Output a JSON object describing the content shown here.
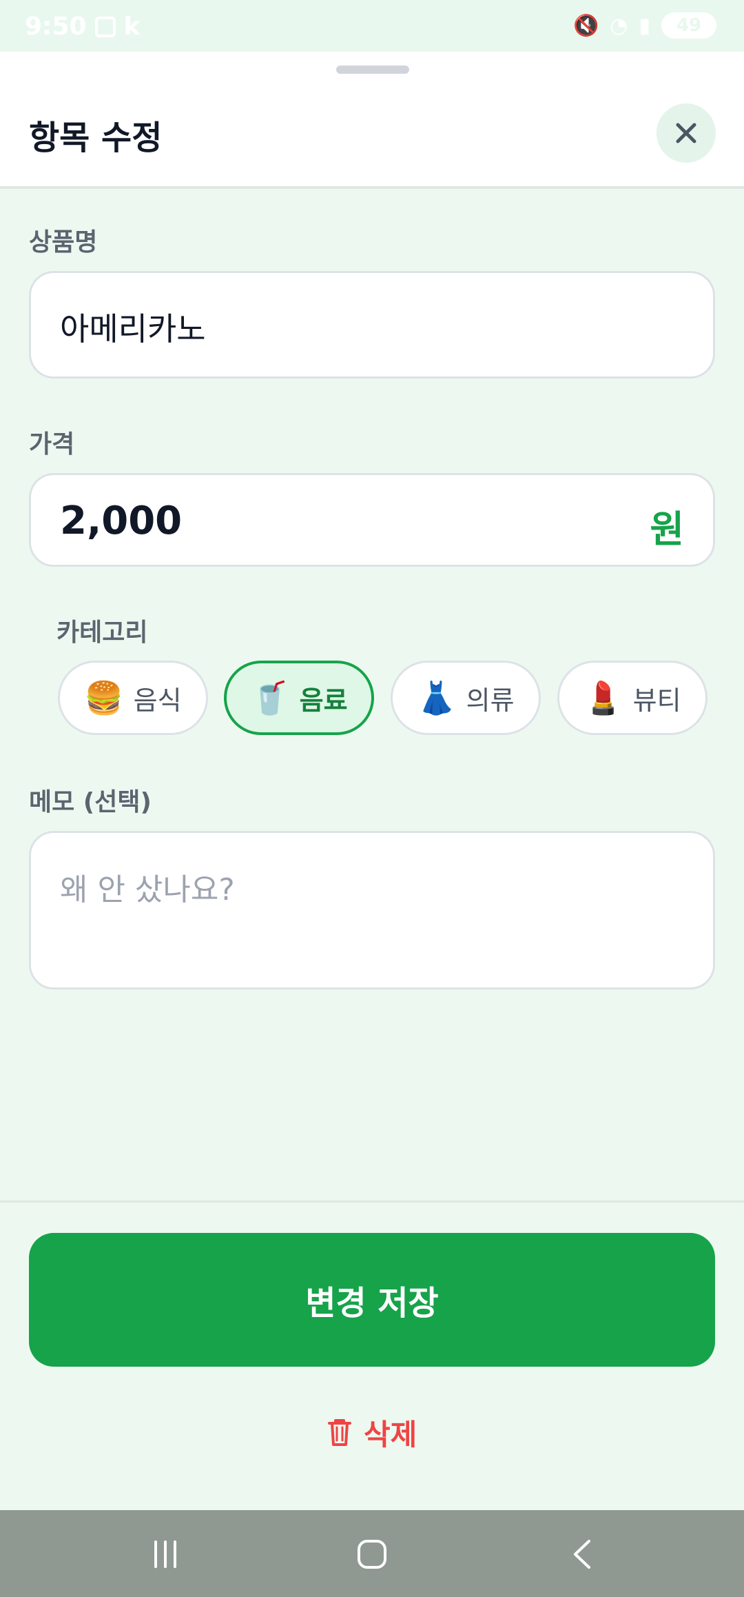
{
  "status_bar": {
    "time": "9:50",
    "carrier_indicator": "k",
    "battery": "49"
  },
  "sheet": {
    "title": "항목 수정"
  },
  "form": {
    "product_name": {
      "label": "상품명",
      "value": "아메리카노"
    },
    "price": {
      "label": "가격",
      "value": "2,000",
      "unit": "원"
    },
    "category": {
      "label": "카테고리",
      "options": [
        {
          "icon": "🍔",
          "icon_name": "burger-icon",
          "label": "음식",
          "selected": false
        },
        {
          "icon": "🥤",
          "icon_name": "drink-cup-icon",
          "label": "음료",
          "selected": true
        },
        {
          "icon": "👗",
          "icon_name": "dress-icon",
          "label": "의류",
          "selected": false
        },
        {
          "icon": "💄",
          "icon_name": "lipstick-icon",
          "label": "뷰티",
          "selected": false
        }
      ]
    },
    "memo": {
      "label": "메모 (선택)",
      "placeholder": "왜 안 샀나요?"
    }
  },
  "actions": {
    "save_label": "변경 저장",
    "delete_label": "삭제"
  },
  "colors": {
    "accent": "#16a34a",
    "delete": "#ef4444",
    "background": "#edf9f0"
  }
}
